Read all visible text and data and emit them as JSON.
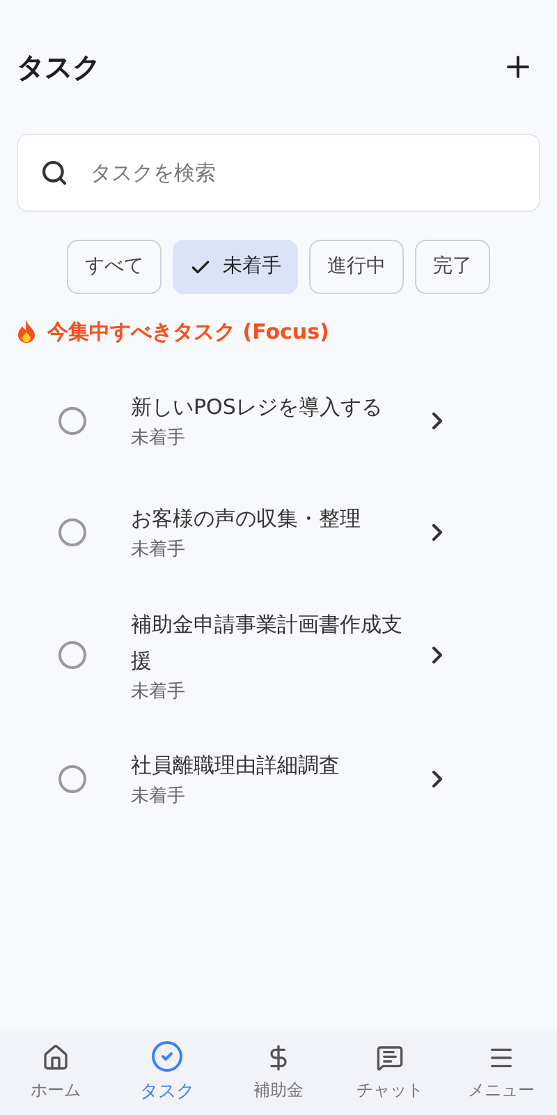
{
  "header": {
    "title": "タスク"
  },
  "search": {
    "placeholder": "タスクを検索"
  },
  "filters": [
    {
      "label": "すべて",
      "selected": false
    },
    {
      "label": "未着手",
      "selected": true
    },
    {
      "label": "進行中",
      "selected": false
    },
    {
      "label": "完了",
      "selected": false
    }
  ],
  "focus": {
    "title": "今集中すべきタスク (Focus)"
  },
  "tasks": [
    {
      "title": "新しいPOSレジを導入する",
      "status": "未着手",
      "done": false
    },
    {
      "title": "お客様の声の収集・整理",
      "status": "未着手",
      "done": false
    },
    {
      "title": "補助金申請事業計画書作成支援",
      "status": "未着手",
      "done": false
    },
    {
      "title": "社員離職理由詳細調査",
      "status": "未着手",
      "done": false
    }
  ],
  "nav": [
    {
      "kind": "home",
      "label": "ホーム",
      "selected": false
    },
    {
      "kind": "tasks",
      "label": "タスク",
      "selected": true
    },
    {
      "kind": "money",
      "label": "補助金",
      "selected": false
    },
    {
      "kind": "chat",
      "label": "チャット",
      "selected": false
    },
    {
      "kind": "menu",
      "label": "メニュー",
      "selected": false
    }
  ]
}
